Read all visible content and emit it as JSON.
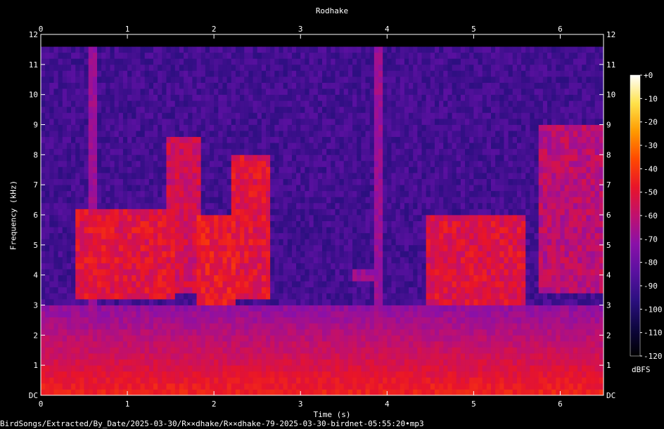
{
  "chart_data": {
    "type": "heatmap",
    "title": "Rodhake",
    "xlabel": "Time (s)",
    "ylabel": "Frequency (kHz)",
    "xlim": [
      0,
      6.5
    ],
    "ylim": [
      0,
      12
    ],
    "x_ticks": [
      "0",
      "1",
      "2",
      "3",
      "4",
      "5",
      "6"
    ],
    "y_ticks": [
      "DC",
      "1",
      "2",
      "3",
      "4",
      "5",
      "6",
      "7",
      "8",
      "9",
      "10",
      "11",
      "12"
    ],
    "colorbar": {
      "unit": "dBFS",
      "range": [
        -120,
        0
      ],
      "ticks": [
        "+0",
        "-10",
        "-20",
        "-30",
        "-40",
        "-50",
        "-60",
        "-70",
        "-80",
        "-90",
        "-100",
        "-110",
        "-120"
      ],
      "colormap": [
        "#000000",
        "#0e0640",
        "#2c0f80",
        "#5a10a0",
        "#8a10a8",
        "#c0106e",
        "#e8142a",
        "#ff4800",
        "#ff9a00",
        "#ffe24a",
        "#ffffff"
      ]
    },
    "background_level_dbfs": -90,
    "broadband_clicks_s": [
      0.6,
      3.9
    ],
    "calls": [
      {
        "t_start": 0.4,
        "t_end": 1.55,
        "f_low_khz": 3.2,
        "f_high_khz": 6.2,
        "peak_dbfs": -45
      },
      {
        "t_start": 1.45,
        "t_end": 1.85,
        "f_low_khz": 3.5,
        "f_high_khz": 8.6,
        "peak_dbfs": -50
      },
      {
        "t_start": 1.8,
        "t_end": 2.25,
        "f_low_khz": 3.0,
        "f_high_khz": 6.0,
        "peak_dbfs": -42
      },
      {
        "t_start": 2.2,
        "t_end": 2.65,
        "f_low_khz": 3.2,
        "f_high_khz": 7.9,
        "peak_dbfs": -45
      },
      {
        "t_start": 3.6,
        "t_end": 3.85,
        "f_low_khz": 3.8,
        "f_high_khz": 4.1,
        "peak_dbfs": -62
      },
      {
        "t_start": 4.45,
        "t_end": 5.6,
        "f_low_khz": 3.0,
        "f_high_khz": 6.0,
        "peak_dbfs": -46
      },
      {
        "t_start": 5.75,
        "t_end": 6.5,
        "f_low_khz": 3.5,
        "f_high_khz": 9.0,
        "peak_dbfs": -55
      }
    ]
  },
  "file_path": "BirdSongs/Extracted/By_Date/2025-03-30/R××dhake/R××dhake-79-2025-03-30-birdnet-05:55:20•mp3"
}
